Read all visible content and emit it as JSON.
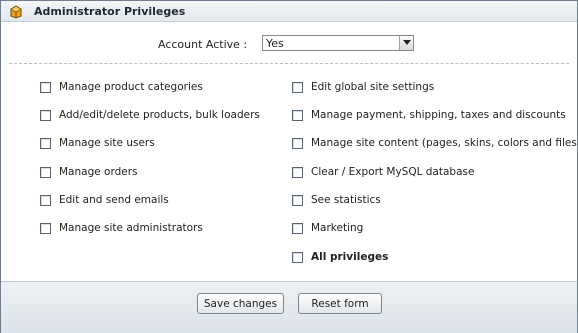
{
  "panel": {
    "title": "Administrator Privileges",
    "icon": "privileges-icon"
  },
  "account": {
    "label": "Account Active :",
    "selected": "Yes"
  },
  "privileges": {
    "left": [
      {
        "label": "Manage product categories",
        "checked": false
      },
      {
        "label": "Add/edit/delete products, bulk loaders",
        "checked": false
      },
      {
        "label": "Manage site users",
        "checked": false
      },
      {
        "label": "Manage orders",
        "checked": false
      },
      {
        "label": "Edit and send emails",
        "checked": false
      },
      {
        "label": "Manage site administrators",
        "checked": false
      }
    ],
    "right": [
      {
        "label": "Edit global site settings",
        "checked": false
      },
      {
        "label": "Manage payment, shipping, taxes and discounts",
        "checked": false
      },
      {
        "label": "Manage site content (pages, skins, colors and files)",
        "checked": false
      },
      {
        "label": "Clear / Export MySQL database",
        "checked": false
      },
      {
        "label": "See statistics",
        "checked": false
      },
      {
        "label": "Marketing",
        "checked": false
      },
      {
        "label": "All privileges",
        "checked": false
      }
    ]
  },
  "buttons": {
    "save": "Save changes",
    "reset": "Reset form"
  }
}
